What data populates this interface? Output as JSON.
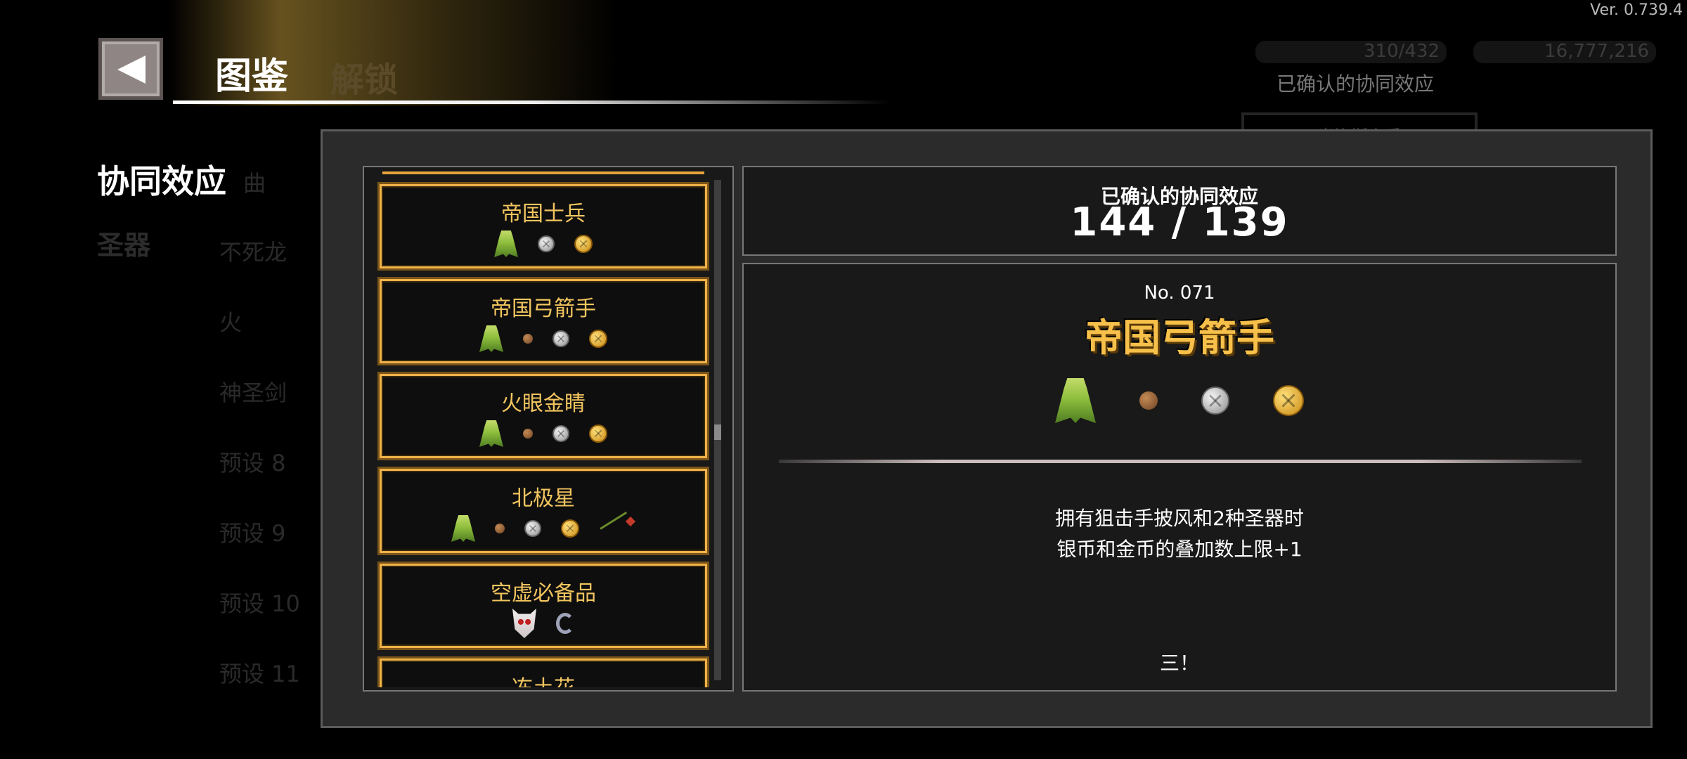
{
  "version": "Ver. 0.739.4",
  "header": {
    "title": "图鉴",
    "ghost_text": "解锁"
  },
  "background": {
    "stat1": "310/432",
    "stat2": "16,777,216",
    "confirmed_label": "已确认的协同效应",
    "card_label": "米洛斯之手",
    "fragment": "曲",
    "sidebar_items": [
      "不死龙",
      "火",
      "神圣剑",
      "预设 8",
      "预设 9",
      "预设 10",
      "预设 11"
    ]
  },
  "sidebar": {
    "title": "协同效应",
    "subtitle": "圣器"
  },
  "list": {
    "items": [
      {
        "name": "帝国士兵",
        "icons": [
          "green-cloak",
          "silver-coin",
          "gold-coin"
        ]
      },
      {
        "name": "帝国弓箭手",
        "icons": [
          "green-cloak",
          "copper-coin",
          "silver-coin",
          "gold-coin"
        ]
      },
      {
        "name": "火眼金睛",
        "icons": [
          "green-cloak",
          "copper-coin",
          "silver-coin",
          "gold-coin"
        ]
      },
      {
        "name": "北极星",
        "icons": [
          "green-cloak",
          "copper-coin",
          "silver-coin",
          "gold-coin",
          "arrow"
        ]
      },
      {
        "name": "空虚必备品",
        "icons": [
          "demon-mask",
          "ring"
        ]
      },
      {
        "name": "冻土花",
        "icons": []
      }
    ]
  },
  "counter": {
    "label": "已确认的协同效应",
    "value": "144 / 139"
  },
  "detail": {
    "number": "No. 071",
    "name": "帝国弓箭手",
    "icons": [
      "green-cloak",
      "copper-coin",
      "silver-coin",
      "gold-coin"
    ],
    "desc_line1": "拥有狙击手披风和2种圣器时",
    "desc_line2": "银币和金币的叠加数上限+1",
    "footer": "三！"
  }
}
